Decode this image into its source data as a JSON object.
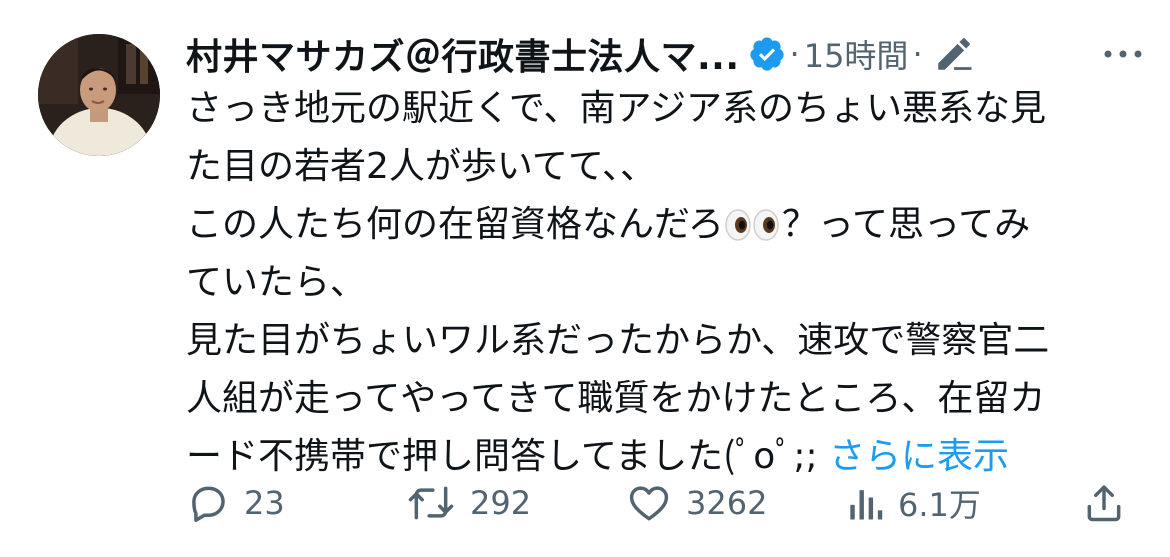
{
  "author": {
    "display_name": "村井マサカズ＠行政書士法人マ...",
    "verified": true,
    "verified_color": "#1d9bf0"
  },
  "meta": {
    "separator": "·",
    "timestamp": "15時間"
  },
  "tweet": {
    "lines": [
      "さっき地元の駅近くで、南アジア系のちょい悪系な見",
      "た目の若者2人が歩いてて、、",
      "この人たち何の在留資格なんだろ",
      "？って思ってみ",
      "ていたら、",
      "見た目がちょいワル系だったからか、速攻で警察官二",
      "人組が走ってやってきて職質をかけたところ、在留カ",
      "ード不携帯で押し問答してました(ﾟoﾟ;; "
    ],
    "show_more": "さらに表示",
    "link_color": "#1d9bf0"
  },
  "actions": {
    "reply_count": "23",
    "retweet_count": "292",
    "like_count": "3262",
    "view_count": "6.1万"
  },
  "icons": {
    "verified": "verified-badge-icon",
    "edit": "edit-pencil-icon",
    "more": "more-dots-icon",
    "reply": "reply-bubble-icon",
    "retweet": "retweet-icon",
    "like": "heart-icon",
    "views": "views-chart-icon",
    "share": "share-icon",
    "eyes": "eyes-emoji-icon"
  }
}
